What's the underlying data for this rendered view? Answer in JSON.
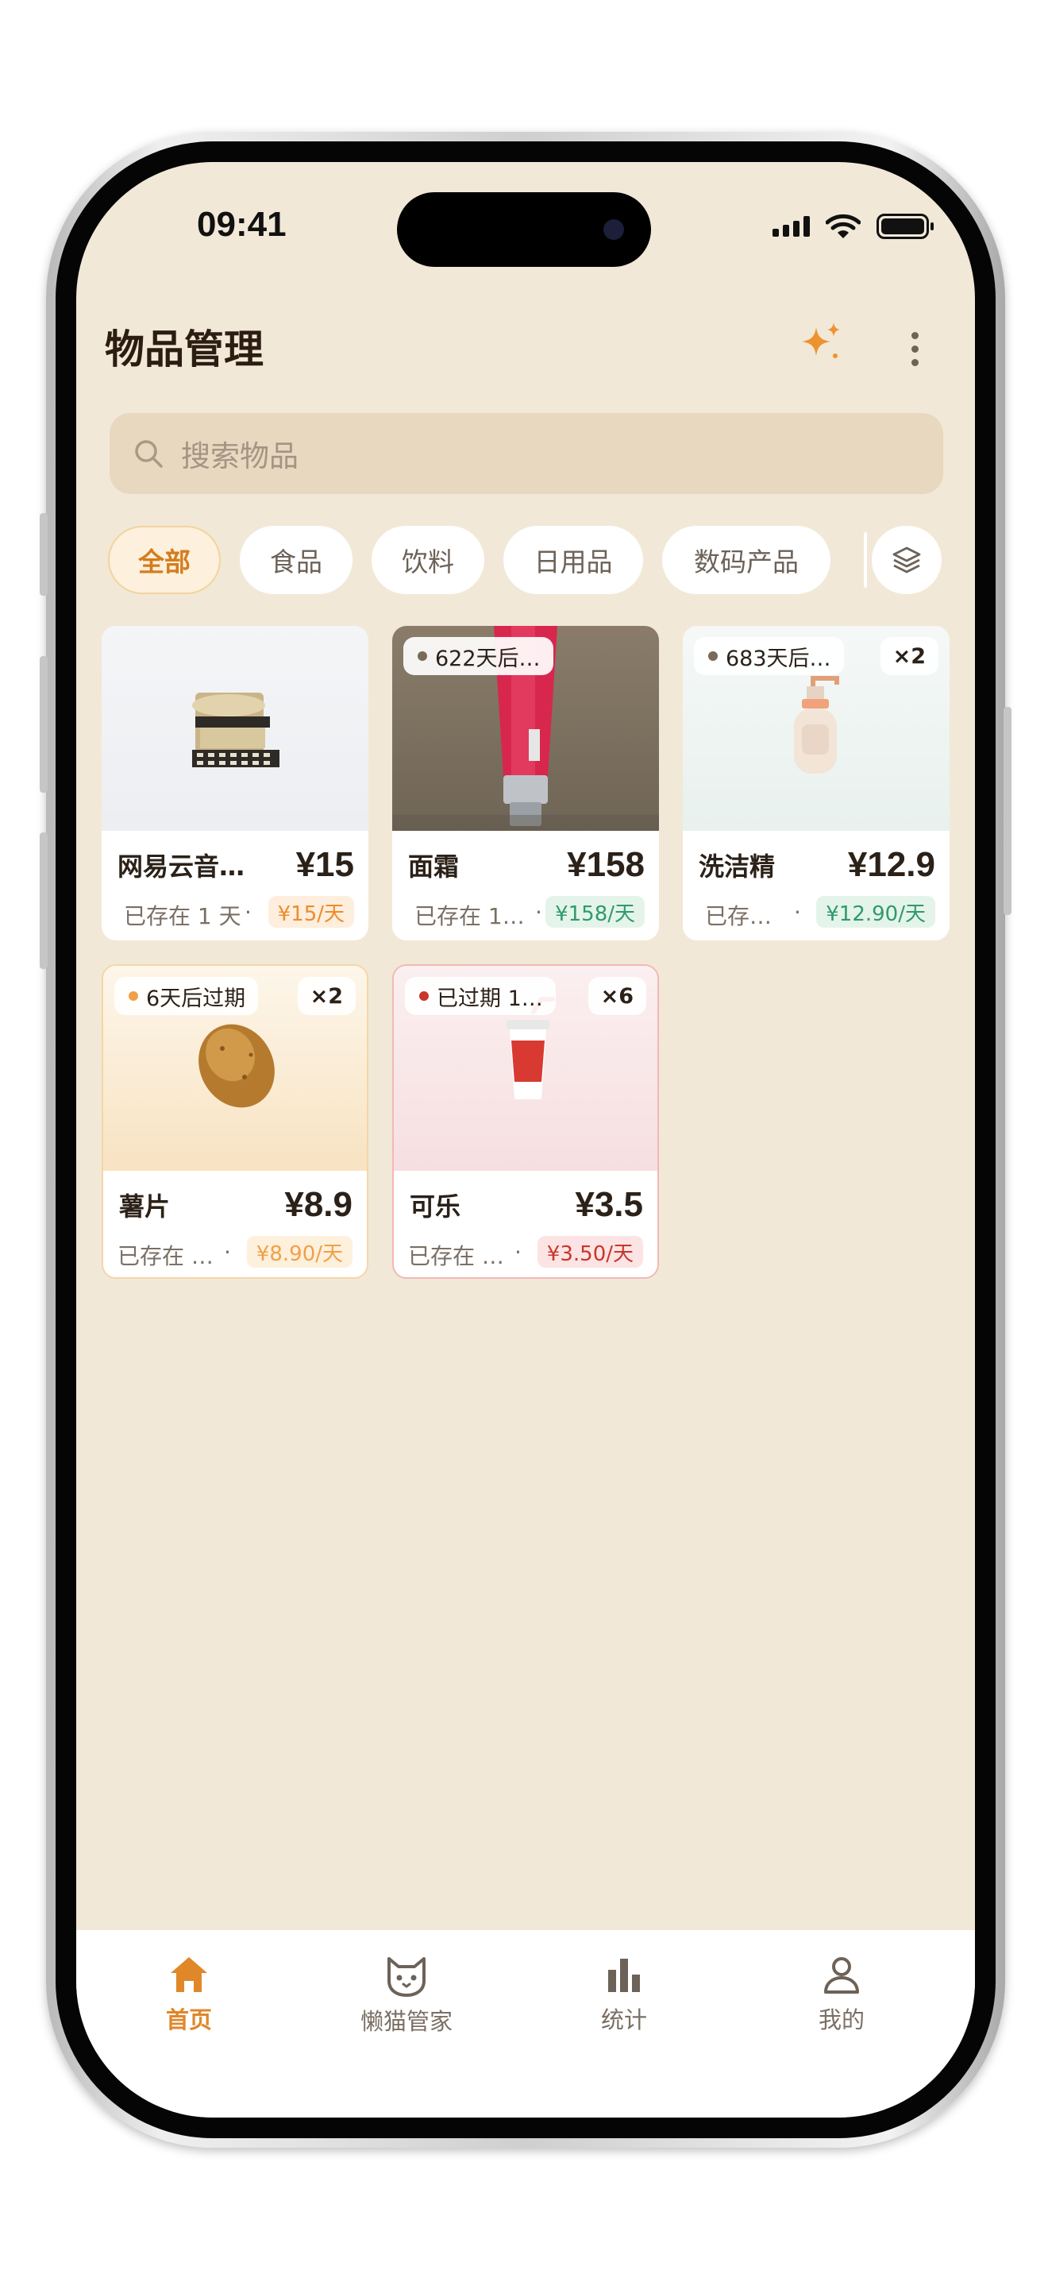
{
  "status_bar": {
    "time": "09:41"
  },
  "header": {
    "title": "物品管理",
    "sparkle_icon": "sparkle-icon",
    "more_icon": "more-vertical-icon"
  },
  "search": {
    "placeholder": "搜索物品",
    "icon": "search-icon"
  },
  "categories": [
    {
      "label": "全部",
      "active": true
    },
    {
      "label": "食品",
      "active": false
    },
    {
      "label": "饮料",
      "active": false
    },
    {
      "label": "日用品",
      "active": false
    },
    {
      "label": "数码产品",
      "active": false
    }
  ],
  "category_manage_icon": "layers-icon",
  "items": [
    {
      "name": "网易云音…",
      "price": "¥15",
      "stored": "已存在 1 天",
      "daily": "¥15/天",
      "image": "film-reel"
    },
    {
      "name": "面霜",
      "price": "¥158",
      "stored": "已存在 1…",
      "daily": "¥158/天",
      "expiry": "622天后…",
      "image": "face-cream-tube"
    },
    {
      "name": "洗洁精",
      "price": "¥12.9",
      "stored": "已存…",
      "daily": "¥12.90/天",
      "expiry": "683天后…",
      "quantity": "×2",
      "image": "soap-bottle"
    },
    {
      "name": "薯片",
      "price": "¥8.9",
      "stored": "已存在 …",
      "daily": "¥8.90/天",
      "expiry": "6天后过期",
      "quantity": "×2",
      "image": "potato"
    },
    {
      "name": "可乐",
      "price": "¥3.5",
      "stored": "已存在 …",
      "daily": "¥3.50/天",
      "expiry": "已过期 1…",
      "quantity": "×6",
      "image": "soda-cup"
    }
  ],
  "tabbar": [
    {
      "label": "首页",
      "icon": "home-icon",
      "active": true
    },
    {
      "label": "懒猫管家",
      "icon": "cat-icon",
      "active": false
    },
    {
      "label": "统计",
      "icon": "bar-chart-icon",
      "active": false
    },
    {
      "label": "我的",
      "icon": "user-icon",
      "active": false
    }
  ],
  "colors": {
    "background": "#f2e8d7",
    "accent": "#e0872a",
    "fresh_green": "#2f9a6a",
    "warning_orange": "#f0a046",
    "expired_red": "#c9362c"
  }
}
